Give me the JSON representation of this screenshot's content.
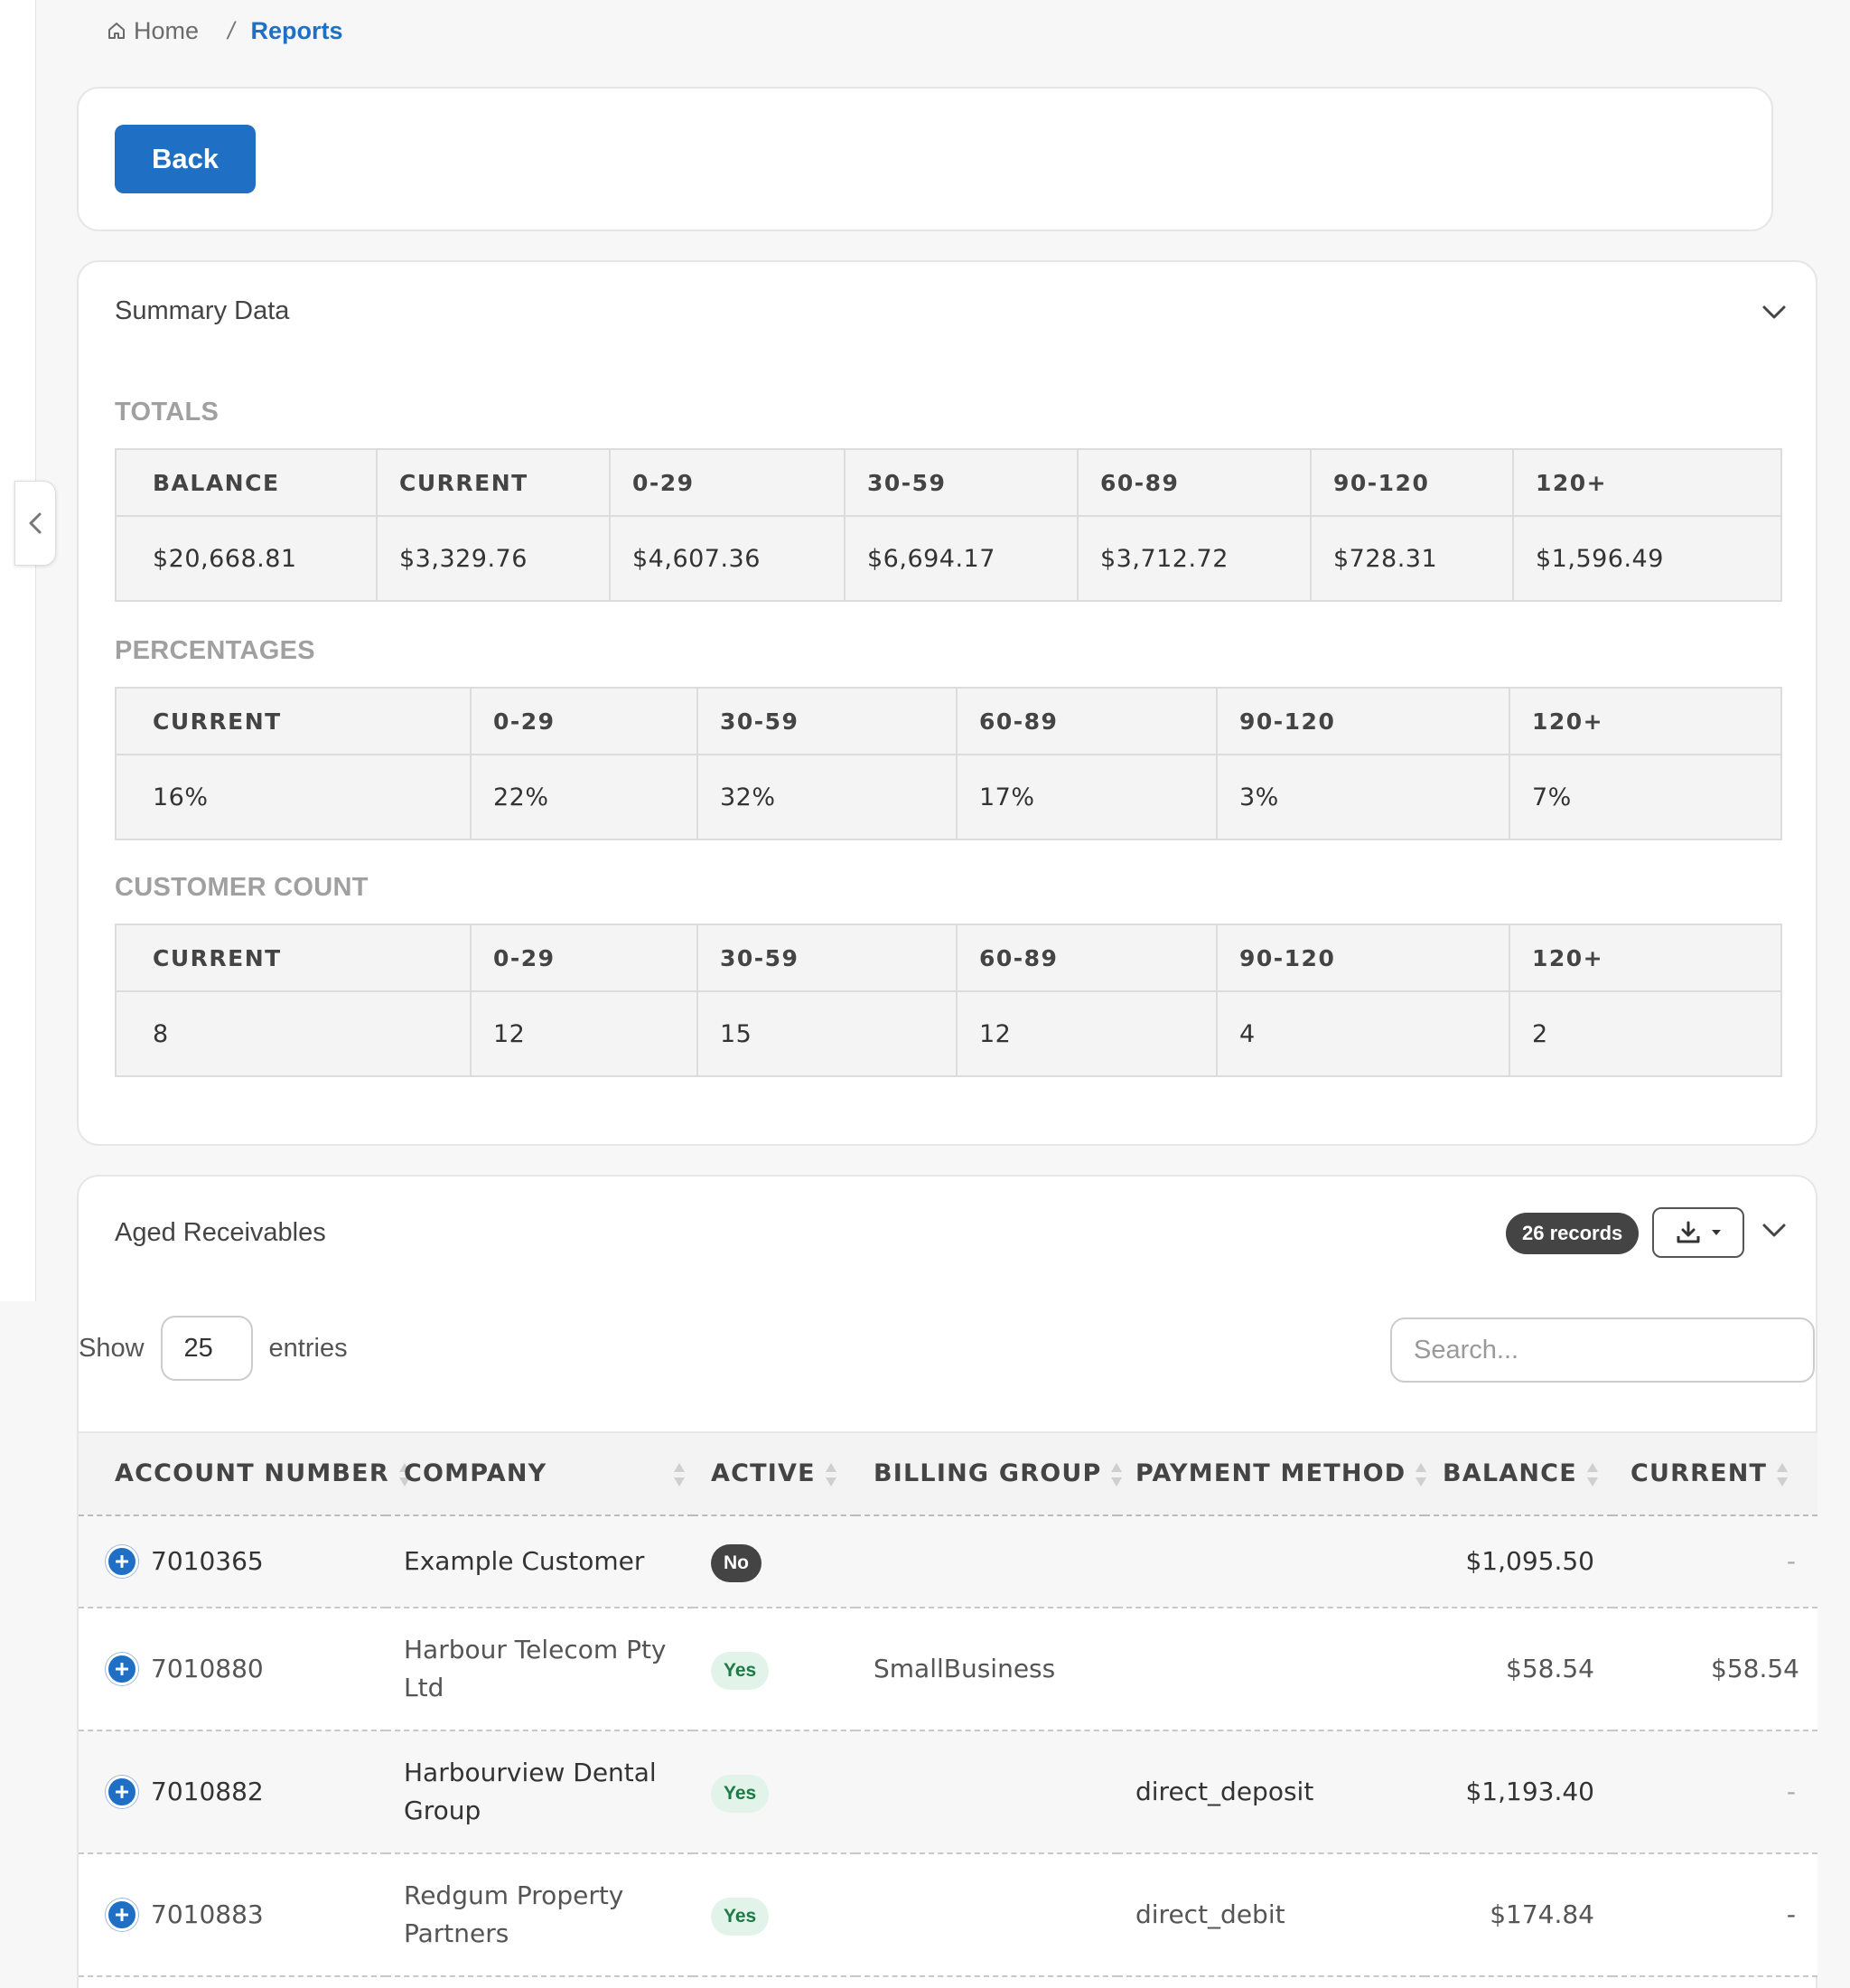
{
  "breadcrumb": {
    "home": "Home",
    "separator": "/",
    "current": "Reports"
  },
  "back_button": "Back",
  "summary": {
    "title": "Summary Data",
    "totals": {
      "label": "TOTALS",
      "headers": [
        "BALANCE",
        "CURRENT",
        "0-29",
        "30-59",
        "60-89",
        "90-120",
        "120+"
      ],
      "values": [
        "$20,668.81",
        "$3,329.76",
        "$4,607.36",
        "$6,694.17",
        "$3,712.72",
        "$728.31",
        "$1,596.49"
      ]
    },
    "percentages": {
      "label": "PERCENTAGES",
      "headers": [
        "CURRENT",
        "0-29",
        "30-59",
        "60-89",
        "90-120",
        "120+"
      ],
      "values": [
        "16%",
        "22%",
        "32%",
        "17%",
        "3%",
        "7%"
      ]
    },
    "customer_count": {
      "label": "CUSTOMER COUNT",
      "headers": [
        "CURRENT",
        "0-29",
        "30-59",
        "60-89",
        "90-120",
        "120+"
      ],
      "values": [
        "8",
        "12",
        "15",
        "12",
        "4",
        "2"
      ]
    }
  },
  "aged": {
    "title": "Aged Receivables",
    "records_badge": "26 records",
    "show_label": "Show",
    "entries_value": "25",
    "entries_label": "entries",
    "search_placeholder": "Search...",
    "columns": [
      "ACCOUNT NUMBER",
      "COMPANY",
      "ACTIVE",
      "BILLING GROUP",
      "PAYMENT METHOD",
      "BALANCE",
      "CURRENT"
    ],
    "rows": [
      {
        "account": "7010365",
        "company": "Example Customer",
        "active": "No",
        "billing_group": "",
        "payment_method": "",
        "balance": "$1,095.50",
        "current": "-"
      },
      {
        "account": "7010880",
        "company": "Harbour Telecom Pty Ltd",
        "active": "Yes",
        "billing_group": "SmallBusiness",
        "payment_method": "",
        "balance": "$58.54",
        "current": "$58.54"
      },
      {
        "account": "7010882",
        "company": "Harbourview Dental Group",
        "active": "Yes",
        "billing_group": "",
        "payment_method": "direct_deposit",
        "balance": "$1,193.40",
        "current": "-"
      },
      {
        "account": "7010883",
        "company": "Redgum Property Partners",
        "active": "Yes",
        "billing_group": "",
        "payment_method": "direct_debit",
        "balance": "$174.84",
        "current": "-"
      }
    ]
  },
  "colors": {
    "primary": "#1f6fc5",
    "badge_dark": "#444444",
    "badge_yes_bg": "#e2f3ea",
    "badge_yes_text": "#1d7a45"
  }
}
